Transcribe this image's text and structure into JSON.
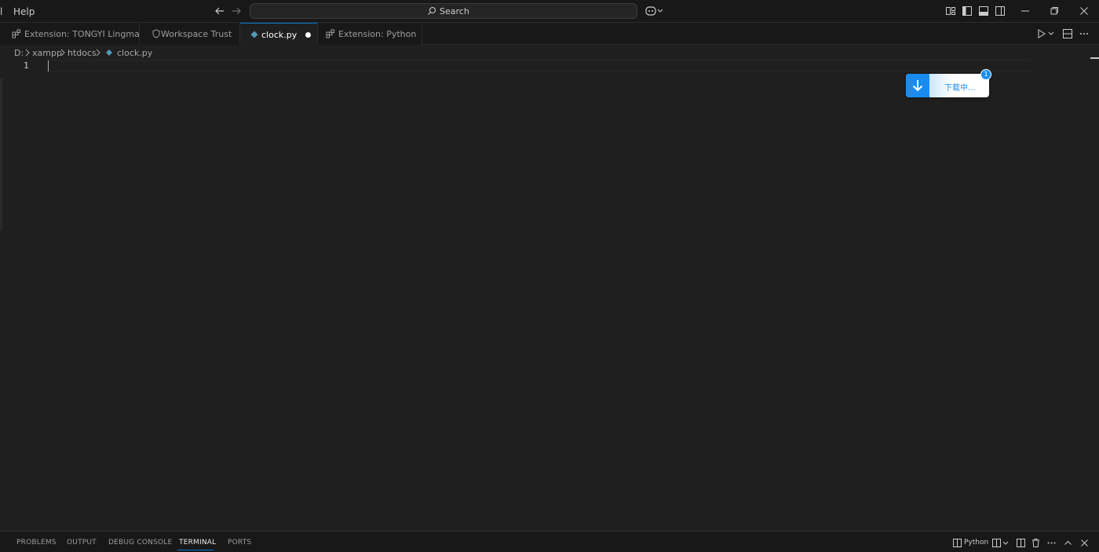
{
  "menu": {
    "partial_left": "l",
    "help": "Help"
  },
  "search": {
    "label": "Search"
  },
  "tabs": [
    {
      "label": "Extension: TONGYI Lingma",
      "icon": "extensions-icon"
    },
    {
      "label": "Workspace Trust",
      "icon": "shield-icon"
    },
    {
      "label": "clock.py",
      "icon": "python-icon",
      "modified": true
    },
    {
      "label": "Extension: Python",
      "icon": "extensions-icon"
    }
  ],
  "breadcrumb": [
    "D:",
    "xampp",
    "htdocs",
    "clock.py"
  ],
  "editor": {
    "line_numbers": [
      "1"
    ]
  },
  "download": {
    "label": "下载中...",
    "badge": "1"
  },
  "panel": {
    "tabs": [
      "PROBLEMS",
      "OUTPUT",
      "DEBUG CONSOLE",
      "TERMINAL",
      "PORTS"
    ],
    "active_tab": "TERMINAL",
    "terminal_label": "Python"
  },
  "colors": {
    "accent": "#0078d4",
    "download_blue": "#1a8cf0",
    "background": "#1f1f1f",
    "chrome": "#181818"
  }
}
